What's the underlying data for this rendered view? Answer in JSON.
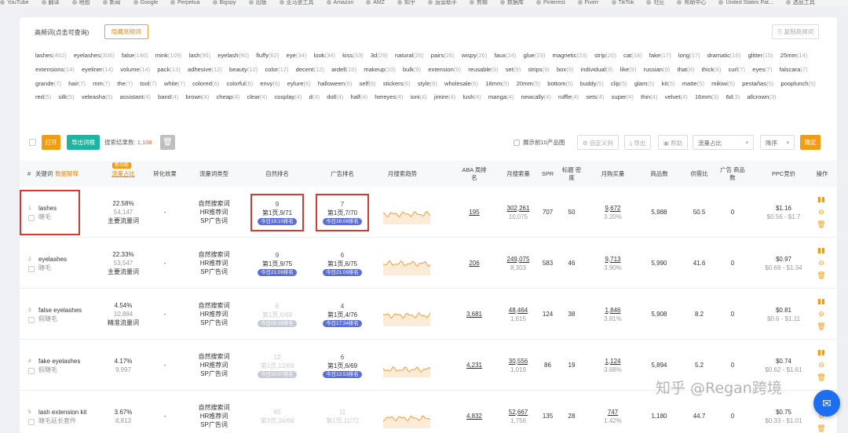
{
  "bookmarks": [
    "YouTube",
    "翻译",
    "地图",
    "新闻",
    "Google",
    "Perpetua",
    "Bigspy",
    "出版",
    "亚马逊工具",
    "Amazon",
    "AMZ",
    "知乎",
    "运营助手",
    "剪辑",
    "数据库",
    "Pinterest",
    "Fiverr",
    "TikTok",
    "社区",
    "帮助中心",
    "United States Pat...",
    "选品工具"
  ],
  "header": {
    "title": "高频词(点击可查询)",
    "hide_btn": "隐藏高频词",
    "copy_btn": "复制高频词"
  },
  "keywords": [
    [
      "lashes",
      "462"
    ],
    [
      "eyelashes",
      "306"
    ],
    [
      "false",
      "146"
    ],
    [
      "mink",
      "109"
    ],
    [
      "lash",
      "96"
    ],
    [
      "eyelash",
      "90"
    ],
    [
      "fluffy",
      "62"
    ],
    [
      "eye",
      "34"
    ],
    [
      "look",
      "34"
    ],
    [
      "kiss",
      "33"
    ],
    [
      "3d",
      "29"
    ],
    [
      "natural",
      "26"
    ],
    [
      "pairs",
      "26"
    ],
    [
      "wispy",
      "26"
    ],
    [
      "faux",
      "24"
    ],
    [
      "glue",
      "23"
    ],
    [
      "magnetic",
      "23"
    ],
    [
      "strip",
      "20"
    ],
    [
      "cat",
      "18"
    ],
    [
      "fake",
      "17"
    ],
    [
      "long",
      "17"
    ],
    [
      "dramatic",
      "16"
    ],
    [
      "glitter",
      "15"
    ],
    [
      "25mm",
      "14"
    ],
    [
      "extensions",
      "14"
    ],
    [
      "eyeliner",
      "14"
    ],
    [
      "volume",
      "14"
    ],
    [
      "pack",
      "13"
    ],
    [
      "adhesive",
      "12"
    ],
    [
      "beauty",
      "12"
    ],
    [
      "color",
      "12"
    ],
    [
      "decent",
      "12"
    ],
    [
      "ardell",
      "10"
    ],
    [
      "makeup",
      "10"
    ],
    [
      "bulk",
      "9"
    ],
    [
      "extension",
      "9"
    ],
    [
      "reusable",
      "9"
    ],
    [
      "set",
      "9"
    ],
    [
      "strips",
      "9"
    ],
    [
      "box",
      "9"
    ],
    [
      "individual",
      "9"
    ],
    [
      "like",
      "9"
    ],
    [
      "russian",
      "9"
    ],
    [
      "that",
      "8"
    ],
    [
      "thick",
      "8"
    ],
    [
      "curl",
      "7"
    ],
    [
      "eyes",
      "7"
    ],
    [
      "falscara",
      "7"
    ],
    [
      "grande",
      "7"
    ],
    [
      "hair",
      "7"
    ],
    [
      "mm",
      "7"
    ],
    [
      "the",
      "7"
    ],
    [
      "tool",
      "7"
    ],
    [
      "white",
      "7"
    ],
    [
      "colored",
      "6"
    ],
    [
      "colorful",
      "6"
    ],
    [
      "envy",
      "6"
    ],
    [
      "eylure",
      "6"
    ],
    [
      "halloween",
      "6"
    ],
    [
      "self",
      "6"
    ],
    [
      "stickers",
      "6"
    ],
    [
      "style",
      "6"
    ],
    [
      "wholesale",
      "6"
    ],
    [
      "18mm",
      "5"
    ],
    [
      "20mm",
      "5"
    ],
    [
      "bottom",
      "5"
    ],
    [
      "buddy",
      "5"
    ],
    [
      "clip",
      "5"
    ],
    [
      "glam",
      "5"
    ],
    [
      "kit",
      "5"
    ],
    [
      "matte",
      "5"
    ],
    [
      "mikiwi",
      "5"
    ],
    [
      "pestañas",
      "5"
    ],
    [
      "pooplunch",
      "5"
    ],
    [
      "red",
      "5"
    ],
    [
      "silk",
      "5"
    ],
    [
      "veleasha",
      "5"
    ],
    [
      "assistant",
      "4"
    ],
    [
      "band",
      "4"
    ],
    [
      "brown",
      "4"
    ],
    [
      "cheap",
      "4"
    ],
    [
      "clear",
      "4"
    ],
    [
      "cosplay",
      "4"
    ],
    [
      "d",
      "4"
    ],
    [
      "doll",
      "4"
    ],
    [
      "half",
      "4"
    ],
    [
      "hereyes",
      "4"
    ],
    [
      "ioni",
      "4"
    ],
    [
      "jimire",
      "4"
    ],
    [
      "lush",
      "4"
    ],
    [
      "manga",
      "4"
    ],
    [
      "newcally",
      "4"
    ],
    [
      "ruffle",
      "4"
    ],
    [
      "sets",
      "4"
    ],
    [
      "super",
      "4"
    ],
    [
      "thin",
      "4"
    ],
    [
      "velvet",
      "4"
    ],
    [
      "16mm",
      "3"
    ],
    [
      "6d",
      "3"
    ],
    [
      "allcrown",
      "3"
    ]
  ],
  "toolbar": {
    "open": "打开",
    "export": "导出词根",
    "result_label": "搜索结果数:",
    "result_count": "1,108",
    "top10": "展示前10产品图",
    "custom": "自定义列",
    "export2": "导出",
    "help": "帮助",
    "flow_placeholder": "流量占比",
    "sort": "降序",
    "sort_btn": "确定"
  },
  "columns": [
    "#",
    "关键词",
    "流量占比",
    "转化效果",
    "流量词类型",
    "自然排名",
    "广告排名",
    "月搜索趋势",
    "ABA 周排名",
    "月搜索量",
    "SPR",
    "标题 密度",
    "月购买量",
    "商品数",
    "供需比",
    "广告 商品数",
    "PPC竞价",
    "操作"
  ],
  "column_extras": {
    "kw_link": "数据解释",
    "flow_tag": "新功能"
  },
  "rows": [
    {
      "n": "1",
      "kw": "lashes",
      "cn": "睫毛",
      "pct": "22.58%",
      "flow": "54,147",
      "type_main": "主要流量词",
      "conv": "-",
      "types": [
        "自然搜索词",
        "HR推荐词",
        "SP广告词"
      ],
      "nat": [
        "9",
        "第1页,9/71",
        "今日19:10排名"
      ],
      "ad": [
        "7",
        "第1页,7/70",
        "今日16:08排名"
      ],
      "aba": "195",
      "msv": "302,261",
      "msv2": "10,075",
      "spr": "707",
      "td": "50",
      "buy": "9,672",
      "buy2": "3.20%",
      "items": "5,988",
      "ratio": "50.5",
      "adi": "0",
      "ppc": "$1.16",
      "ppc2": "$0.56 - $1.7",
      "nat_dim": false,
      "ad_dim": false
    },
    {
      "n": "2",
      "kw": "eyelashes",
      "cn": "睫毛",
      "pct": "22.33%",
      "flow": "53,547",
      "type_main": "主要流量词",
      "conv": "-",
      "types": [
        "自然搜索词",
        "HR推荐词",
        "SP广告词"
      ],
      "nat": [
        "9",
        "第1页,9/75",
        "今日21:09排名"
      ],
      "ad": [
        "6",
        "第1页,6/75",
        "今日21:09排名"
      ],
      "aba": "206",
      "msv": "249,075",
      "msv2": "8,303",
      "spr": "583",
      "td": "46",
      "buy": "9,713",
      "buy2": "3.90%",
      "items": "5,990",
      "ratio": "41.6",
      "adi": "0",
      "ppc": "$0.97",
      "ppc2": "$0.69 - $1.34",
      "nat_dim": false,
      "ad_dim": false
    },
    {
      "n": "3",
      "kw": "false eyelashes",
      "cn": "假睫毛",
      "pct": "4.54%",
      "flow": "10,884",
      "type_main": "精准流量词",
      "conv": "-",
      "types": [
        "自然搜索词",
        "HR推荐词",
        "SP广告词"
      ],
      "nat": [
        "6",
        "第1页,6/69",
        "今日09:39排名"
      ],
      "ad": [
        "4",
        "第1页,4/76",
        "今日17:34排名"
      ],
      "aba": "3,681",
      "msv": "48,464",
      "msv2": "1,615",
      "spr": "124",
      "td": "38",
      "buy": "1,846",
      "buy2": "3.81%",
      "items": "5,908",
      "ratio": "8.2",
      "adi": "0",
      "ppc": "$0.81",
      "ppc2": "$0.6 - $1.11",
      "nat_dim": true,
      "ad_dim": false
    },
    {
      "n": "4",
      "kw": "fake eyelashes",
      "cn": "假睫毛",
      "pct": "4.17%",
      "flow": "9,997",
      "type_main": "",
      "conv": "-",
      "types": [
        "自然搜索词",
        "HR推荐词",
        "SP广告词"
      ],
      "nat": [
        "12",
        "第1页,12/69",
        "今日10:07排名"
      ],
      "ad": [
        "6",
        "第1页,6/69",
        "今日13:53排名"
      ],
      "aba": "4,231",
      "msv": "30,556",
      "msv2": "1,019",
      "spr": "86",
      "td": "19",
      "buy": "1,124",
      "buy2": "3.68%",
      "items": "5,894",
      "ratio": "5.2",
      "adi": "0",
      "ppc": "$0.74",
      "ppc2": "$0.62 - $1.61",
      "nat_dim": true,
      "ad_dim": false
    },
    {
      "n": "5",
      "kw": "lash extension kit",
      "cn": "睫毛延长套件",
      "pct": "3.67%",
      "flow": "8,813",
      "type_main": "",
      "conv": "-",
      "types": [
        "自然搜索词",
        "HR推荐词",
        "SP广告词"
      ],
      "nat": [
        "65",
        "第3页,34/68",
        ""
      ],
      "ad": [
        "11",
        "第1页,11/72",
        ""
      ],
      "aba": "4,832",
      "msv": "52,667",
      "msv2": "1,756",
      "spr": "135",
      "td": "28",
      "buy": "747",
      "buy2": "1.42%",
      "items": "1,180",
      "ratio": "44.7",
      "adi": "0",
      "ppc": "$0.75",
      "ppc2": "$0.33 - $1.01",
      "nat_dim": true,
      "ad_dim": true
    }
  ],
  "watermark": "知乎 @Regan跨境",
  "icons": {
    "trash": "trash-icon",
    "chart": "bar-chart-icon",
    "minus": "minus-circle-icon",
    "delete": "delete-icon",
    "chat": "chat-icon"
  },
  "colors": {
    "orange": "#f39c12",
    "teal": "#1ab6a0",
    "pill": "#5b6fd6",
    "highlight": "#d23b30"
  }
}
